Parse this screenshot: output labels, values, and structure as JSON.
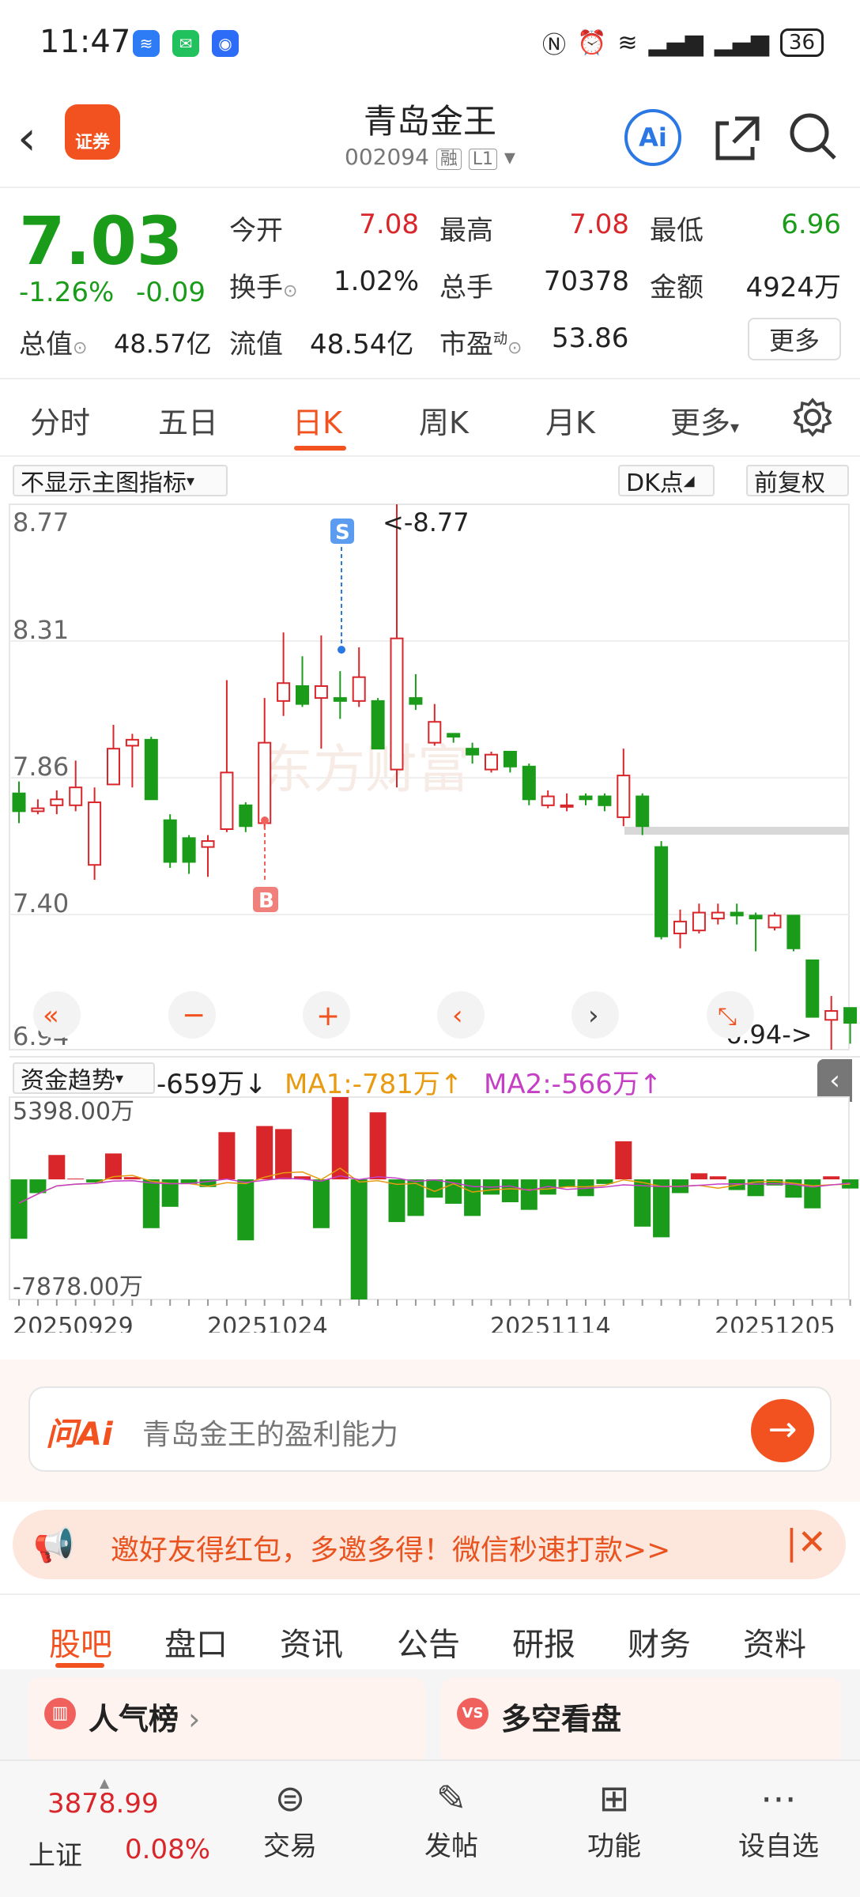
{
  "status_bar": {
    "time": "11:47",
    "battery": "36"
  },
  "header": {
    "title": "青岛金王",
    "code": "002094",
    "tag1": "融",
    "tag2": "L1",
    "logo_text": "证券",
    "ai_label": "Ai"
  },
  "quote": {
    "price": "7.03",
    "change_pct": "-1.26%",
    "change": "-0.09",
    "rows": [
      [
        [
          "今开",
          "7.08"
        ],
        [
          "最高",
          "7.08"
        ],
        [
          "最低",
          "6.96"
        ]
      ],
      [
        [
          "换手",
          "1.02%"
        ],
        [
          "总手",
          "70378"
        ],
        [
          "金额",
          "4924万"
        ]
      ]
    ],
    "total_value_label": "总值",
    "total_value": "48.57亿",
    "float_value_label": "流值",
    "float_value": "48.54亿",
    "pe_label": "市盈",
    "pe_sup": "动",
    "pe_value": "53.86",
    "more": "更多",
    "colors": {
      "up": "#d9262b",
      "down": "#1a9c1a",
      "accent": "#f2521f"
    }
  },
  "chart_tabs": [
    "分时",
    "五日",
    "日K",
    "周K",
    "月K",
    "更多"
  ],
  "chart_toolbar": {
    "indicator": "不显示主图指标",
    "dk": "DK点",
    "adjust": "前复权"
  },
  "chart_data": [
    {
      "type": "candlestick",
      "y_ticks": [
        "8.77",
        "8.31",
        "7.86",
        "7.40",
        "6.94"
      ],
      "ylim": [
        6.94,
        8.77
      ],
      "high_label": "<-8.77",
      "low_label": "6.94->",
      "signals": {
        "sell": "S",
        "buy": "B"
      },
      "x_ticks": [
        "20250929",
        "20251024",
        "20251114",
        "20251205"
      ],
      "candles": [
        {
          "o": 7.8,
          "c": 7.74,
          "h": 7.84,
          "l": 7.7
        },
        {
          "o": 7.74,
          "c": 7.75,
          "h": 7.78,
          "l": 7.73
        },
        {
          "o": 7.76,
          "c": 7.78,
          "h": 7.81,
          "l": 7.73
        },
        {
          "o": 7.76,
          "c": 7.82,
          "h": 7.91,
          "l": 7.74
        },
        {
          "o": 7.56,
          "c": 7.77,
          "h": 7.82,
          "l": 7.51
        },
        {
          "o": 7.83,
          "c": 7.95,
          "h": 8.03,
          "l": 7.83
        },
        {
          "o": 7.96,
          "c": 7.98,
          "h": 8.0,
          "l": 7.82
        },
        {
          "o": 7.98,
          "c": 7.78,
          "h": 7.99,
          "l": 7.78
        },
        {
          "o": 7.71,
          "c": 7.57,
          "h": 7.73,
          "l": 7.55
        },
        {
          "o": 7.65,
          "c": 7.57,
          "h": 7.66,
          "l": 7.53
        },
        {
          "o": 7.62,
          "c": 7.64,
          "h": 7.66,
          "l": 7.52
        },
        {
          "o": 7.68,
          "c": 7.87,
          "h": 8.18,
          "l": 7.67
        },
        {
          "o": 7.76,
          "c": 7.69,
          "h": 7.77,
          "l": 7.67
        },
        {
          "o": 7.7,
          "c": 7.97,
          "h": 8.12,
          "l": 7.68
        },
        {
          "o": 8.11,
          "c": 8.17,
          "h": 8.34,
          "l": 8.06
        },
        {
          "o": 8.16,
          "c": 8.1,
          "h": 8.26,
          "l": 8.09
        },
        {
          "o": 8.12,
          "c": 8.16,
          "h": 8.33,
          "l": 7.95
        },
        {
          "o": 8.12,
          "c": 8.11,
          "h": 8.21,
          "l": 8.05
        },
        {
          "o": 8.11,
          "c": 8.19,
          "h": 8.29,
          "l": 8.09
        },
        {
          "o": 8.11,
          "c": 7.95,
          "h": 8.12,
          "l": 7.95
        },
        {
          "o": 7.88,
          "c": 8.32,
          "h": 8.77,
          "l": 7.82
        },
        {
          "o": 8.12,
          "c": 8.1,
          "h": 8.2,
          "l": 8.08
        },
        {
          "o": 7.97,
          "c": 8.04,
          "h": 8.1,
          "l": 7.96
        },
        {
          "o": 8.0,
          "c": 7.99,
          "h": 8.0,
          "l": 7.97
        },
        {
          "o": 7.95,
          "c": 7.93,
          "h": 7.97,
          "l": 7.9
        },
        {
          "o": 7.88,
          "c": 7.93,
          "h": 7.94,
          "l": 7.87
        },
        {
          "o": 7.94,
          "c": 7.89,
          "h": 7.94,
          "l": 7.87
        },
        {
          "o": 7.89,
          "c": 7.78,
          "h": 7.9,
          "l": 7.76
        },
        {
          "o": 7.76,
          "c": 7.79,
          "h": 7.81,
          "l": 7.75
        },
        {
          "o": 7.76,
          "c": 7.76,
          "h": 7.8,
          "l": 7.74
        },
        {
          "o": 7.79,
          "c": 7.78,
          "h": 7.8,
          "l": 7.76
        },
        {
          "o": 7.79,
          "c": 7.76,
          "h": 7.8,
          "l": 7.74
        },
        {
          "o": 7.72,
          "c": 7.86,
          "h": 7.95,
          "l": 7.69
        },
        {
          "o": 7.79,
          "c": 7.69,
          "h": 7.8,
          "l": 7.66
        },
        {
          "o": 7.62,
          "c": 7.32,
          "h": 7.64,
          "l": 7.31
        },
        {
          "o": 7.33,
          "c": 7.37,
          "h": 7.41,
          "l": 7.28
        },
        {
          "o": 7.34,
          "c": 7.4,
          "h": 7.43,
          "l": 7.33
        },
        {
          "o": 7.38,
          "c": 7.4,
          "h": 7.43,
          "l": 7.36
        },
        {
          "o": 7.4,
          "c": 7.39,
          "h": 7.43,
          "l": 7.36
        },
        {
          "o": 7.39,
          "c": 7.38,
          "h": 7.4,
          "l": 7.27
        },
        {
          "o": 7.35,
          "c": 7.39,
          "h": 7.4,
          "l": 7.34
        },
        {
          "o": 7.39,
          "c": 7.28,
          "h": 7.39,
          "l": 7.27
        },
        {
          "o": 7.24,
          "c": 7.05,
          "h": 7.24,
          "l": 7.05
        },
        {
          "o": 7.04,
          "c": 7.07,
          "h": 7.12,
          "l": 6.94
        },
        {
          "o": 7.08,
          "c": 7.03,
          "h": 7.08,
          "l": 6.96
        }
      ]
    },
    {
      "type": "bar",
      "label": "资金趋势",
      "value": "-659万",
      "ma1": "MA1:-781万",
      "ma2": "MA2:-566万",
      "y_ticks": [
        "5398.00万",
        "-7878.00万"
      ],
      "ylim": [
        -7878,
        5398
      ],
      "values": [
        -3900,
        -900,
        1600,
        50,
        -200,
        1700,
        150,
        -3200,
        -1800,
        -300,
        -500,
        3100,
        -4000,
        3500,
        3300,
        200,
        -3200,
        5398,
        -7878,
        4400,
        -2800,
        -2400,
        -1200,
        -1600,
        -2400,
        -1000,
        -1500,
        -2000,
        -1000,
        -500,
        -1100,
        -300,
        2500,
        -3100,
        -3800,
        -900,
        400,
        200,
        -700,
        -1100,
        -400,
        -1200,
        -1900,
        200,
        -600
      ]
    }
  ],
  "ai_prompt": {
    "brand": "问Ai",
    "placeholder": "青岛金王的盈利能力"
  },
  "promo": {
    "text": "邀好友得红包，多邀多得！微信秒速打款>>"
  },
  "bottom_tabs": [
    "股吧",
    "盘口",
    "资讯",
    "公告",
    "研报",
    "财务",
    "资料"
  ],
  "cards": [
    {
      "title": "人气榜"
    },
    {
      "title": "多空看盘"
    }
  ],
  "nav": {
    "index_value": "3878.99",
    "index_name": "上证",
    "index_change": "0.08%",
    "items": [
      "交易",
      "发帖",
      "功能",
      "设自选"
    ]
  }
}
